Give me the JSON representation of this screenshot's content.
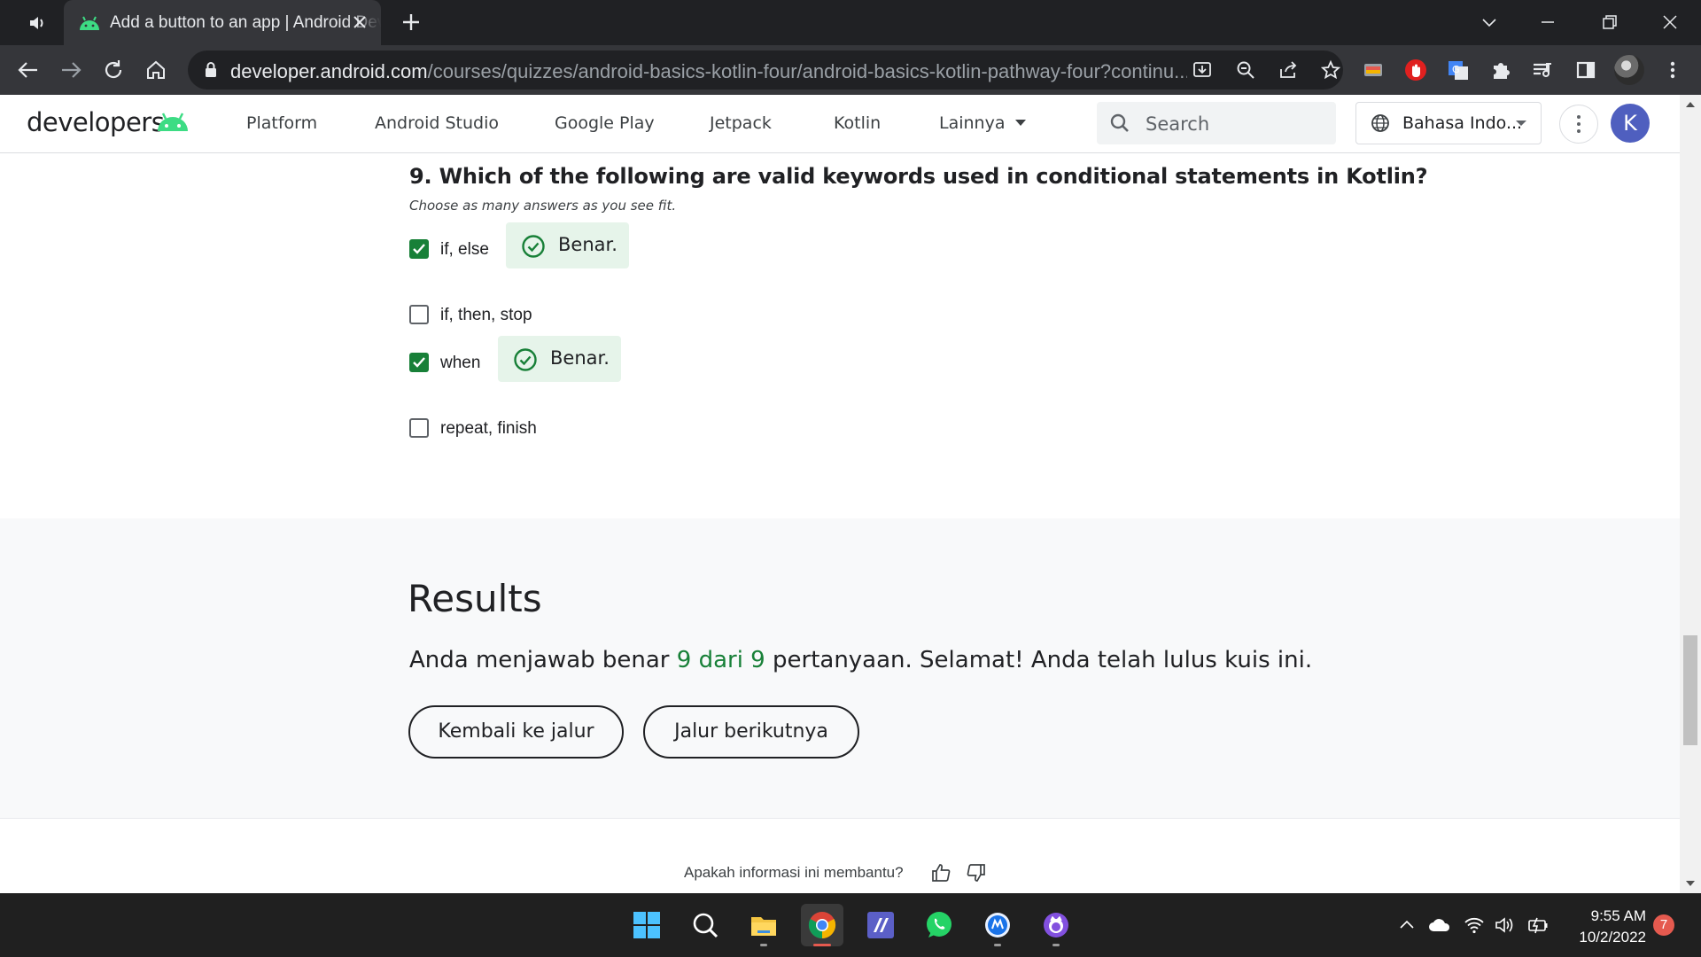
{
  "browser": {
    "tab_title": "Add a button to an app  |  Android Developers",
    "url_host": "developer.android.com",
    "url_path": "/courses/quizzes/android-basics-kotlin-four/android-basics-kotlin-pathway-four?continu..."
  },
  "site": {
    "logo_text": "developers",
    "nav": [
      "Platform",
      "Android Studio",
      "Google Play",
      "Jetpack",
      "Kotlin",
      "Lainnya"
    ],
    "search_placeholder": "Search",
    "language": "Bahasa Indo...",
    "user_initial": "K"
  },
  "quiz": {
    "question": "9. Which of the following are valid keywords used in conditional statements in Kotlin?",
    "hint": "Choose as many answers as you see fit.",
    "options": [
      {
        "label": "if, else",
        "checked": true,
        "feedback": "Benar."
      },
      {
        "label": "if, then, stop",
        "checked": false
      },
      {
        "label": "when",
        "checked": true,
        "feedback": "Benar."
      },
      {
        "label": "repeat, finish",
        "checked": false
      }
    ]
  },
  "results": {
    "heading": "Results",
    "text_before": "Anda menjawab benar ",
    "score": "9 dari 9",
    "text_after": " pertanyaan. Selamat! Anda telah lulus kuis ini.",
    "back_button": "Kembali ke jalur",
    "next_button": "Jalur berikutnya"
  },
  "footer": {
    "helpful_prompt": "Apakah informasi ini membantu?"
  },
  "taskbar": {
    "time": "9:55 AM",
    "date": "10/2/2022",
    "notification_count": "7"
  },
  "colors": {
    "accent_green": "#188038",
    "feedback_bg": "#e6f4ea",
    "android_green": "#3ddc84"
  }
}
